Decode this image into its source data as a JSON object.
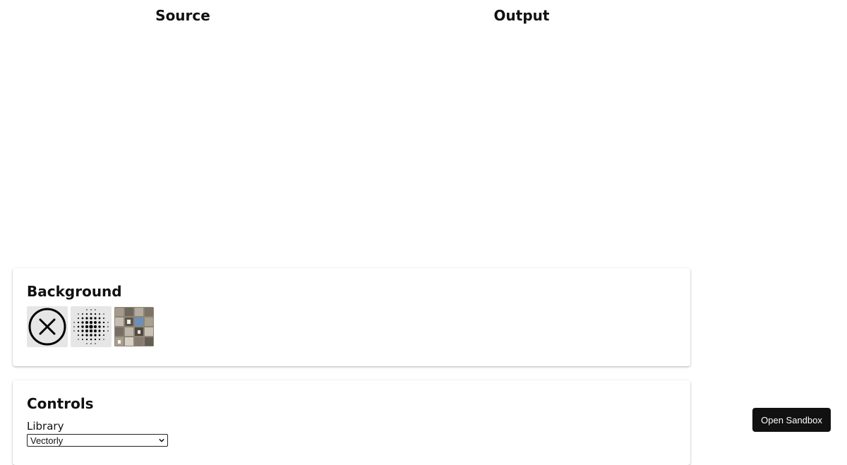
{
  "columns": {
    "source_title": "Source",
    "output_title": "Output"
  },
  "background_panel": {
    "title": "Background",
    "options": [
      {
        "icon": "none-x-circle-icon"
      },
      {
        "icon": "dot-pattern-icon"
      },
      {
        "icon": "photo-collage-icon"
      }
    ]
  },
  "controls_panel": {
    "title": "Controls",
    "library_label": "Library",
    "library_value": "Vectorly"
  },
  "sandbox_button": {
    "label": "Open Sandbox"
  }
}
